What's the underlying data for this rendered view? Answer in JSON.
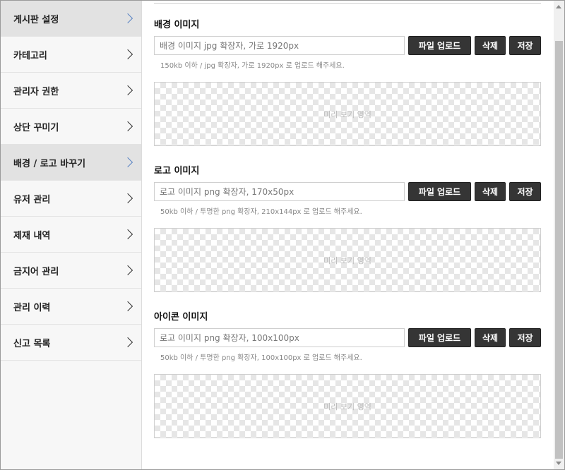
{
  "sidebar": {
    "items": [
      {
        "label": "게시판 설정",
        "active": true
      },
      {
        "label": "카테고리",
        "active": false
      },
      {
        "label": "관리자 권한",
        "active": false
      },
      {
        "label": "상단 꾸미기",
        "active": false
      },
      {
        "label": "배경 / 로고 바꾸기",
        "active": true
      },
      {
        "label": "유저 관리",
        "active": false
      },
      {
        "label": "제재 내역",
        "active": false
      },
      {
        "label": "금지어 관리",
        "active": false
      },
      {
        "label": "관리 이력",
        "active": false
      },
      {
        "label": "신고 목록",
        "active": false
      }
    ]
  },
  "sections": [
    {
      "title": "배경 이미지",
      "placeholder": "배경 이미지 jpg 확장자, 가로 1920px",
      "upload_label": "파일 업로드",
      "delete_label": "삭제",
      "save_label": "저장",
      "hint": "150kb 이하 / jpg 확장자, 가로 1920px 로 업로드 해주세요.",
      "preview_label": "미리 보기 영역"
    },
    {
      "title": "로고 이미지",
      "placeholder": "로고 이미지 png 확장자, 170x50px",
      "upload_label": "파일 업로드",
      "delete_label": "삭제",
      "save_label": "저장",
      "hint": "50kb 이하 / 투명한 png 확장자, 210x144px 로 업로드 해주세요.",
      "preview_label": "미리 보기 영역"
    },
    {
      "title": "아이콘 이미지",
      "placeholder": "로고 이미지 png 확장자, 100x100px",
      "upload_label": "파일 업로드",
      "delete_label": "삭제",
      "save_label": "저장",
      "hint": "50kb 이하 / 투명한 png 확장자, 100x100px 로 업로드 해주세요.",
      "preview_label": "미리 보기 영역"
    }
  ],
  "colors": {
    "button_bg": "#353535",
    "active_item_bg": "#e2e2e2",
    "active_chevron": "#5b84c4"
  },
  "icons": {
    "sidebar_chevron": "chevron-right-icon",
    "scroll_up": "scroll-up-arrow-icon",
    "scroll_down": "scroll-down-arrow-icon"
  }
}
